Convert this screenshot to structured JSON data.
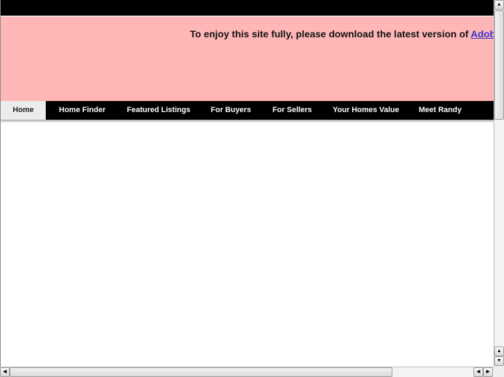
{
  "banner": {
    "message": "To enjoy this site fully, please download the latest version of ",
    "link": "Adobe Flash Player"
  },
  "nav": {
    "items": [
      {
        "label": "Home",
        "active": true
      },
      {
        "label": "Home Finder"
      },
      {
        "label": "Featured Listings"
      },
      {
        "label": "For Buyers"
      },
      {
        "label": "For Sellers"
      },
      {
        "label": "Your Homes Value"
      },
      {
        "label": "Meet Randy"
      }
    ]
  },
  "colors": {
    "banner_bg": "#ffb6b6",
    "nav_bg": "#000000",
    "link": "#3333cc"
  },
  "icons": {
    "up": "▲",
    "down": "▼",
    "left": "◀",
    "right": "▶"
  }
}
